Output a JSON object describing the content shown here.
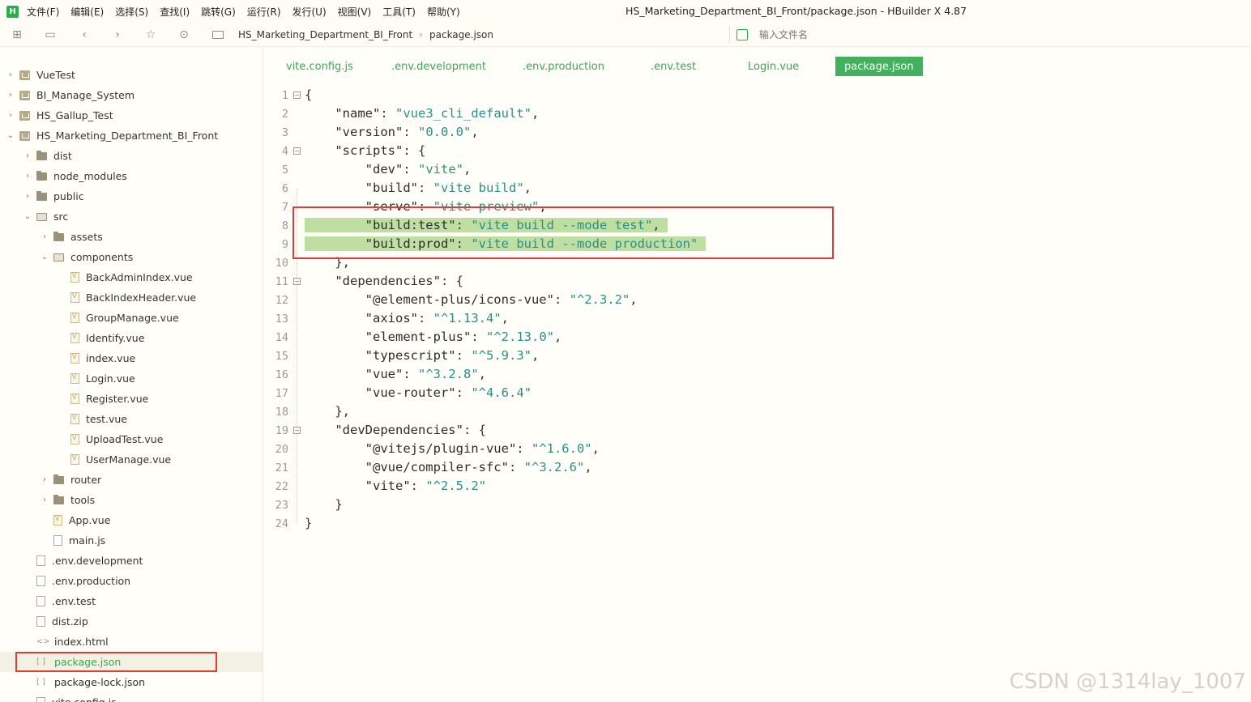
{
  "app": {
    "logo": "H",
    "window_title": "HS_Marketing_Department_BI_Front/package.json - HBuilder X 4.87"
  },
  "menu": [
    "文件(F)",
    "编辑(E)",
    "选择(S)",
    "查找(I)",
    "跳转(G)",
    "运行(R)",
    "发行(U)",
    "视图(V)",
    "工具(T)",
    "帮助(Y)"
  ],
  "toolbar": {
    "breadcrumb": [
      "HS_Marketing_Department_BI_Front",
      "package.json"
    ],
    "file_search_placeholder": "输入文件名"
  },
  "sidebar": {
    "items": [
      {
        "label": "VueTest",
        "type": "project",
        "chev": "›"
      },
      {
        "label": "BI_Manage_System",
        "type": "project",
        "chev": "›"
      },
      {
        "label": "HS_Gallup_Test",
        "type": "project",
        "chev": "›"
      },
      {
        "label": "HS_Marketing_Department_BI_Front",
        "type": "project",
        "chev": "⌄"
      },
      {
        "label": "dist",
        "type": "folder",
        "chev": "›"
      },
      {
        "label": "node_modules",
        "type": "folder",
        "chev": "›"
      },
      {
        "label": "public",
        "type": "folder",
        "chev": "›"
      },
      {
        "label": "src",
        "type": "folder-open",
        "chev": "⌄"
      },
      {
        "label": "assets",
        "type": "folder",
        "chev": "›"
      },
      {
        "label": "components",
        "type": "folder-open",
        "chev": "⌄"
      },
      {
        "label": "BackAdminIndex.vue",
        "type": "vue",
        "chev": ""
      },
      {
        "label": "BackIndexHeader.vue",
        "type": "vue",
        "chev": ""
      },
      {
        "label": "GroupManage.vue",
        "type": "vue",
        "chev": ""
      },
      {
        "label": "Identify.vue",
        "type": "vue",
        "chev": ""
      },
      {
        "label": "index.vue",
        "type": "vue",
        "chev": ""
      },
      {
        "label": "Login.vue",
        "type": "vue",
        "chev": ""
      },
      {
        "label": "Register.vue",
        "type": "vue",
        "chev": ""
      },
      {
        "label": "test.vue",
        "type": "vue",
        "chev": ""
      },
      {
        "label": "UploadTest.vue",
        "type": "vue",
        "chev": ""
      },
      {
        "label": "UserManage.vue",
        "type": "vue",
        "chev": ""
      },
      {
        "label": "router",
        "type": "folder",
        "chev": "›"
      },
      {
        "label": "tools",
        "type": "folder",
        "chev": "›"
      },
      {
        "label": "App.vue",
        "type": "vue",
        "chev": ""
      },
      {
        "label": "main.js",
        "type": "js",
        "chev": ""
      },
      {
        "label": ".env.development",
        "type": "file",
        "chev": ""
      },
      {
        "label": ".env.production",
        "type": "file",
        "chev": ""
      },
      {
        "label": ".env.test",
        "type": "file",
        "chev": ""
      },
      {
        "label": "dist.zip",
        "type": "file",
        "chev": ""
      },
      {
        "label": "index.html",
        "type": "html",
        "chev": ""
      },
      {
        "label": "package.json",
        "type": "json",
        "chev": "",
        "selected": true
      },
      {
        "label": "package-lock.json",
        "type": "json",
        "chev": ""
      },
      {
        "label": "vite.config.js",
        "type": "js",
        "chev": ""
      }
    ]
  },
  "tabs": [
    {
      "label": "vite.config.js",
      "active": false
    },
    {
      "label": ".env.development",
      "active": false
    },
    {
      "label": ".env.production",
      "active": false
    },
    {
      "label": ".env.test",
      "active": false
    },
    {
      "label": "Login.vue",
      "active": false
    },
    {
      "label": "package.json",
      "active": true
    }
  ],
  "editor": {
    "lines": [
      {
        "n": "1",
        "fold": true,
        "code": "{",
        "hl": false
      },
      {
        "n": "2",
        "fold": false,
        "code": "    \"name\": \"vue3_cli_default\",",
        "hl": false
      },
      {
        "n": "3",
        "fold": false,
        "code": "    \"version\": \"0.0.0\",",
        "hl": false
      },
      {
        "n": "4",
        "fold": true,
        "code": "    \"scripts\": {",
        "hl": false
      },
      {
        "n": "5",
        "fold": false,
        "code": "        \"dev\": \"vite\",",
        "hl": false
      },
      {
        "n": "6",
        "fold": false,
        "code": "        \"build\": \"vite build\",",
        "hl": false
      },
      {
        "n": "7",
        "fold": false,
        "code": "        \"serve\": \"vite preview\",",
        "hl": false
      },
      {
        "n": "8",
        "fold": false,
        "code": "        \"build:test\": \"vite build --mode test\", ",
        "hl": true
      },
      {
        "n": "9",
        "fold": false,
        "code": "        \"build:prod\": \"vite build --mode production\" ",
        "hl": true
      },
      {
        "n": "10",
        "fold": false,
        "code": "    },",
        "hl": false
      },
      {
        "n": "11",
        "fold": true,
        "code": "    \"dependencies\": {",
        "hl": false
      },
      {
        "n": "12",
        "fold": false,
        "code": "        \"@element-plus/icons-vue\": \"^2.3.2\",",
        "hl": false
      },
      {
        "n": "13",
        "fold": false,
        "code": "        \"axios\": \"^1.13.4\",",
        "hl": false
      },
      {
        "n": "14",
        "fold": false,
        "code": "        \"element-plus\": \"^2.13.0\",",
        "hl": false
      },
      {
        "n": "15",
        "fold": false,
        "code": "        \"typescript\": \"^5.9.3\",",
        "hl": false
      },
      {
        "n": "16",
        "fold": false,
        "code": "        \"vue\": \"^3.2.8\",",
        "hl": false
      },
      {
        "n": "17",
        "fold": false,
        "code": "        \"vue-router\": \"^4.6.4\"",
        "hl": false
      },
      {
        "n": "18",
        "fold": false,
        "code": "    },",
        "hl": false
      },
      {
        "n": "19",
        "fold": true,
        "code": "    \"devDependencies\": {",
        "hl": false
      },
      {
        "n": "20",
        "fold": false,
        "code": "        \"@vitejs/plugin-vue\": \"^1.6.0\",",
        "hl": false
      },
      {
        "n": "21",
        "fold": false,
        "code": "        \"@vue/compiler-sfc\": \"^3.2.6\",",
        "hl": false
      },
      {
        "n": "22",
        "fold": false,
        "code": "        \"vite\": \"^2.5.2\"",
        "hl": false
      },
      {
        "n": "23",
        "fold": false,
        "code": "    }",
        "hl": false
      },
      {
        "n": "24",
        "fold": false,
        "code": "}",
        "hl": false
      }
    ]
  },
  "watermark": "CSDN @1314lay_1007",
  "colors": {
    "accent": "#42b05c",
    "annotation": "#e53935",
    "highlight": "#bfdfa2",
    "string": "#2c8f86"
  }
}
